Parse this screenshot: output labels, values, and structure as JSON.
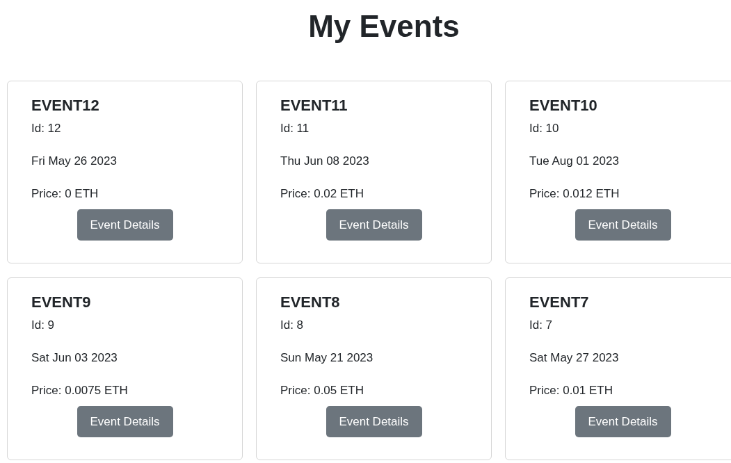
{
  "title": "My Events",
  "events": [
    {
      "name": "EVENT12",
      "id": "Id: 12",
      "date": "Fri May 26 2023",
      "price": "Price: 0 ETH",
      "button": "Event Details"
    },
    {
      "name": "EVENT11",
      "id": "Id: 11",
      "date": "Thu Jun 08 2023",
      "price": "Price: 0.02 ETH",
      "button": "Event Details"
    },
    {
      "name": "EVENT10",
      "id": "Id: 10",
      "date": "Tue Aug 01 2023",
      "price": "Price: 0.012 ETH",
      "button": "Event Details"
    },
    {
      "name": "EVENT9",
      "id": "Id: 9",
      "date": "Sat Jun 03 2023",
      "price": "Price: 0.0075 ETH",
      "button": "Event Details"
    },
    {
      "name": "EVENT8",
      "id": "Id: 8",
      "date": "Sun May 21 2023",
      "price": "Price: 0.05 ETH",
      "button": "Event Details"
    },
    {
      "name": "EVENT7",
      "id": "Id: 7",
      "date": "Sat May 27 2023",
      "price": "Price: 0.01 ETH",
      "button": "Event Details"
    }
  ]
}
